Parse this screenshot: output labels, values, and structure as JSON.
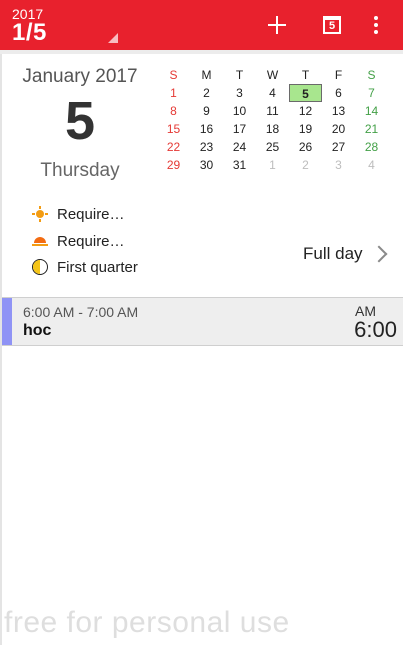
{
  "toolbar": {
    "year": "2017",
    "date": "1/5",
    "add_icon": "plus-icon",
    "today_icon_label": "5",
    "more_icon": "more-vert-icon",
    "color": "#e8212d"
  },
  "date_panel": {
    "month_year": "January 2017",
    "day": "5",
    "weekday": "Thursday"
  },
  "mini_calendar": {
    "headers": [
      "S",
      "M",
      "T",
      "W",
      "T",
      "F",
      "S"
    ],
    "weeks": [
      [
        "1",
        "2",
        "3",
        "4",
        "5",
        "6",
        "7"
      ],
      [
        "8",
        "9",
        "10",
        "11",
        "12",
        "13",
        "14"
      ],
      [
        "15",
        "16",
        "17",
        "18",
        "19",
        "20",
        "21"
      ],
      [
        "22",
        "23",
        "24",
        "25",
        "26",
        "27",
        "28"
      ],
      [
        "29",
        "30",
        "31",
        "1",
        "2",
        "3",
        "4"
      ]
    ],
    "selected": "5",
    "today_color": "#a8e68e",
    "sunday_color": "#e53935",
    "saturday_color": "#43a047"
  },
  "info": {
    "sunrise": "Require…",
    "sunset": "Require…",
    "moon_phase": "First quarter"
  },
  "full_day_label": "Full day",
  "event": {
    "time_range": "6:00 AM - 7:00 AM",
    "title": "hoc",
    "ampm": "AM",
    "start_time": "6:00",
    "color": "#8f93f5"
  },
  "watermark": "free for personal use"
}
